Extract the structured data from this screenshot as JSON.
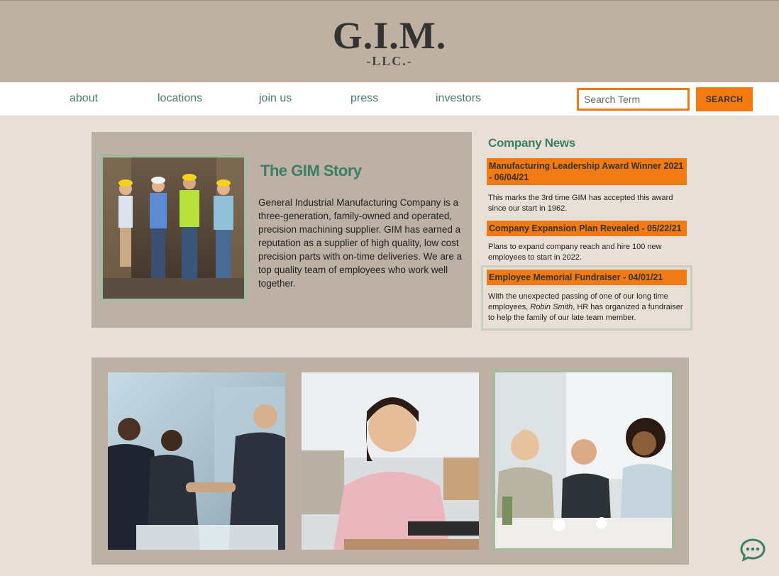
{
  "logo": {
    "main": "G.I.M.",
    "sub": "-LLC.-"
  },
  "nav": {
    "items": [
      {
        "label": "about"
      },
      {
        "label": "locations"
      },
      {
        "label": "join us"
      },
      {
        "label": "press"
      },
      {
        "label": "investors"
      }
    ],
    "search_placeholder": "Search Term",
    "search_button": "SEARCH"
  },
  "story": {
    "title": "The GIM Story",
    "text": "General Industrial Manufacturing Company is a three-generation, family-owned and operated, precision machining supplier. GIM has earned a reputation as a supplier of high quality, low cost precision parts with on-time deliveries. We are a top quality team of employees who work well together."
  },
  "news": {
    "heading": "Company News",
    "items": [
      {
        "title": "Manufacturing Leadership Award Winner 2021 - 06/04/21",
        "body": "This marks the 3rd time GIM has accepted this award since our start in 1962."
      },
      {
        "title": "Company Expansion Plan Revealed - 05/22/21",
        "body": "Plans to expand company reach and hire 100 new employees to start in 2022."
      },
      {
        "title": "Employee Memorial Fundraiser - 04/01/21",
        "body_pre": "With the unexpected passing of one of our long time employees, ",
        "body_name": "Robin Smith",
        "body_post": ", HR has organized a fundraiser to help the family of our late team member."
      }
    ]
  },
  "colors": {
    "accent_orange": "#f47a10",
    "brand_green": "#3d7e68",
    "panel_tan": "#bcb1a4",
    "background": "#e8e0d6"
  },
  "icons": {
    "chat": "chat-bubble-icon"
  }
}
